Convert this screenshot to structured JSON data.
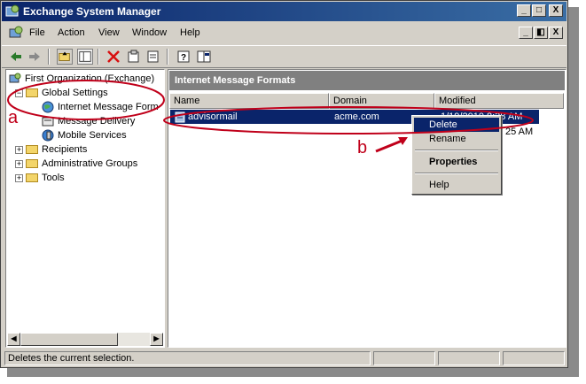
{
  "window": {
    "title": "Exchange System Manager",
    "title_buttons": [
      "_",
      "□",
      "X"
    ],
    "doc_buttons": [
      "_",
      "◧",
      "X"
    ]
  },
  "menu": [
    "File",
    "Action",
    "View",
    "Window",
    "Help"
  ],
  "toolbar": [
    "back-icon",
    "forward-icon",
    "up-folder-icon",
    "show-tree-icon",
    "delete-icon",
    "properties-icon",
    "export-list-icon",
    "help-icon",
    "console-icon"
  ],
  "tree": {
    "root": "First Organization (Exchange)",
    "global_settings": "Global Settings",
    "internet_message_formats": "Internet Message Form",
    "message_delivery": "Message Delivery",
    "mobile_services": "Mobile Services",
    "recipients": "Recipients",
    "administrative_groups": "Administrative Groups",
    "tools": "Tools"
  },
  "right_pane": {
    "title": "Internet Message Formats",
    "columns": [
      "Name",
      "Domain",
      "Modified"
    ],
    "rows": [
      {
        "name": "advisormail",
        "domain": "acme.com",
        "modified": "1/19/2010 8:38 AM"
      },
      {
        "name": "",
        "domain": "",
        "modified": "25 AM"
      }
    ]
  },
  "context_menu": {
    "delete": "Delete",
    "rename": "Rename",
    "properties": "Properties",
    "help": "Help"
  },
  "status": {
    "message": "Deletes the current selection."
  },
  "annotations": {
    "a": "a",
    "b": "b"
  },
  "colors": {
    "selection": "#0a246a",
    "annotation": "#c0001a",
    "face": "#d4d0c8"
  }
}
